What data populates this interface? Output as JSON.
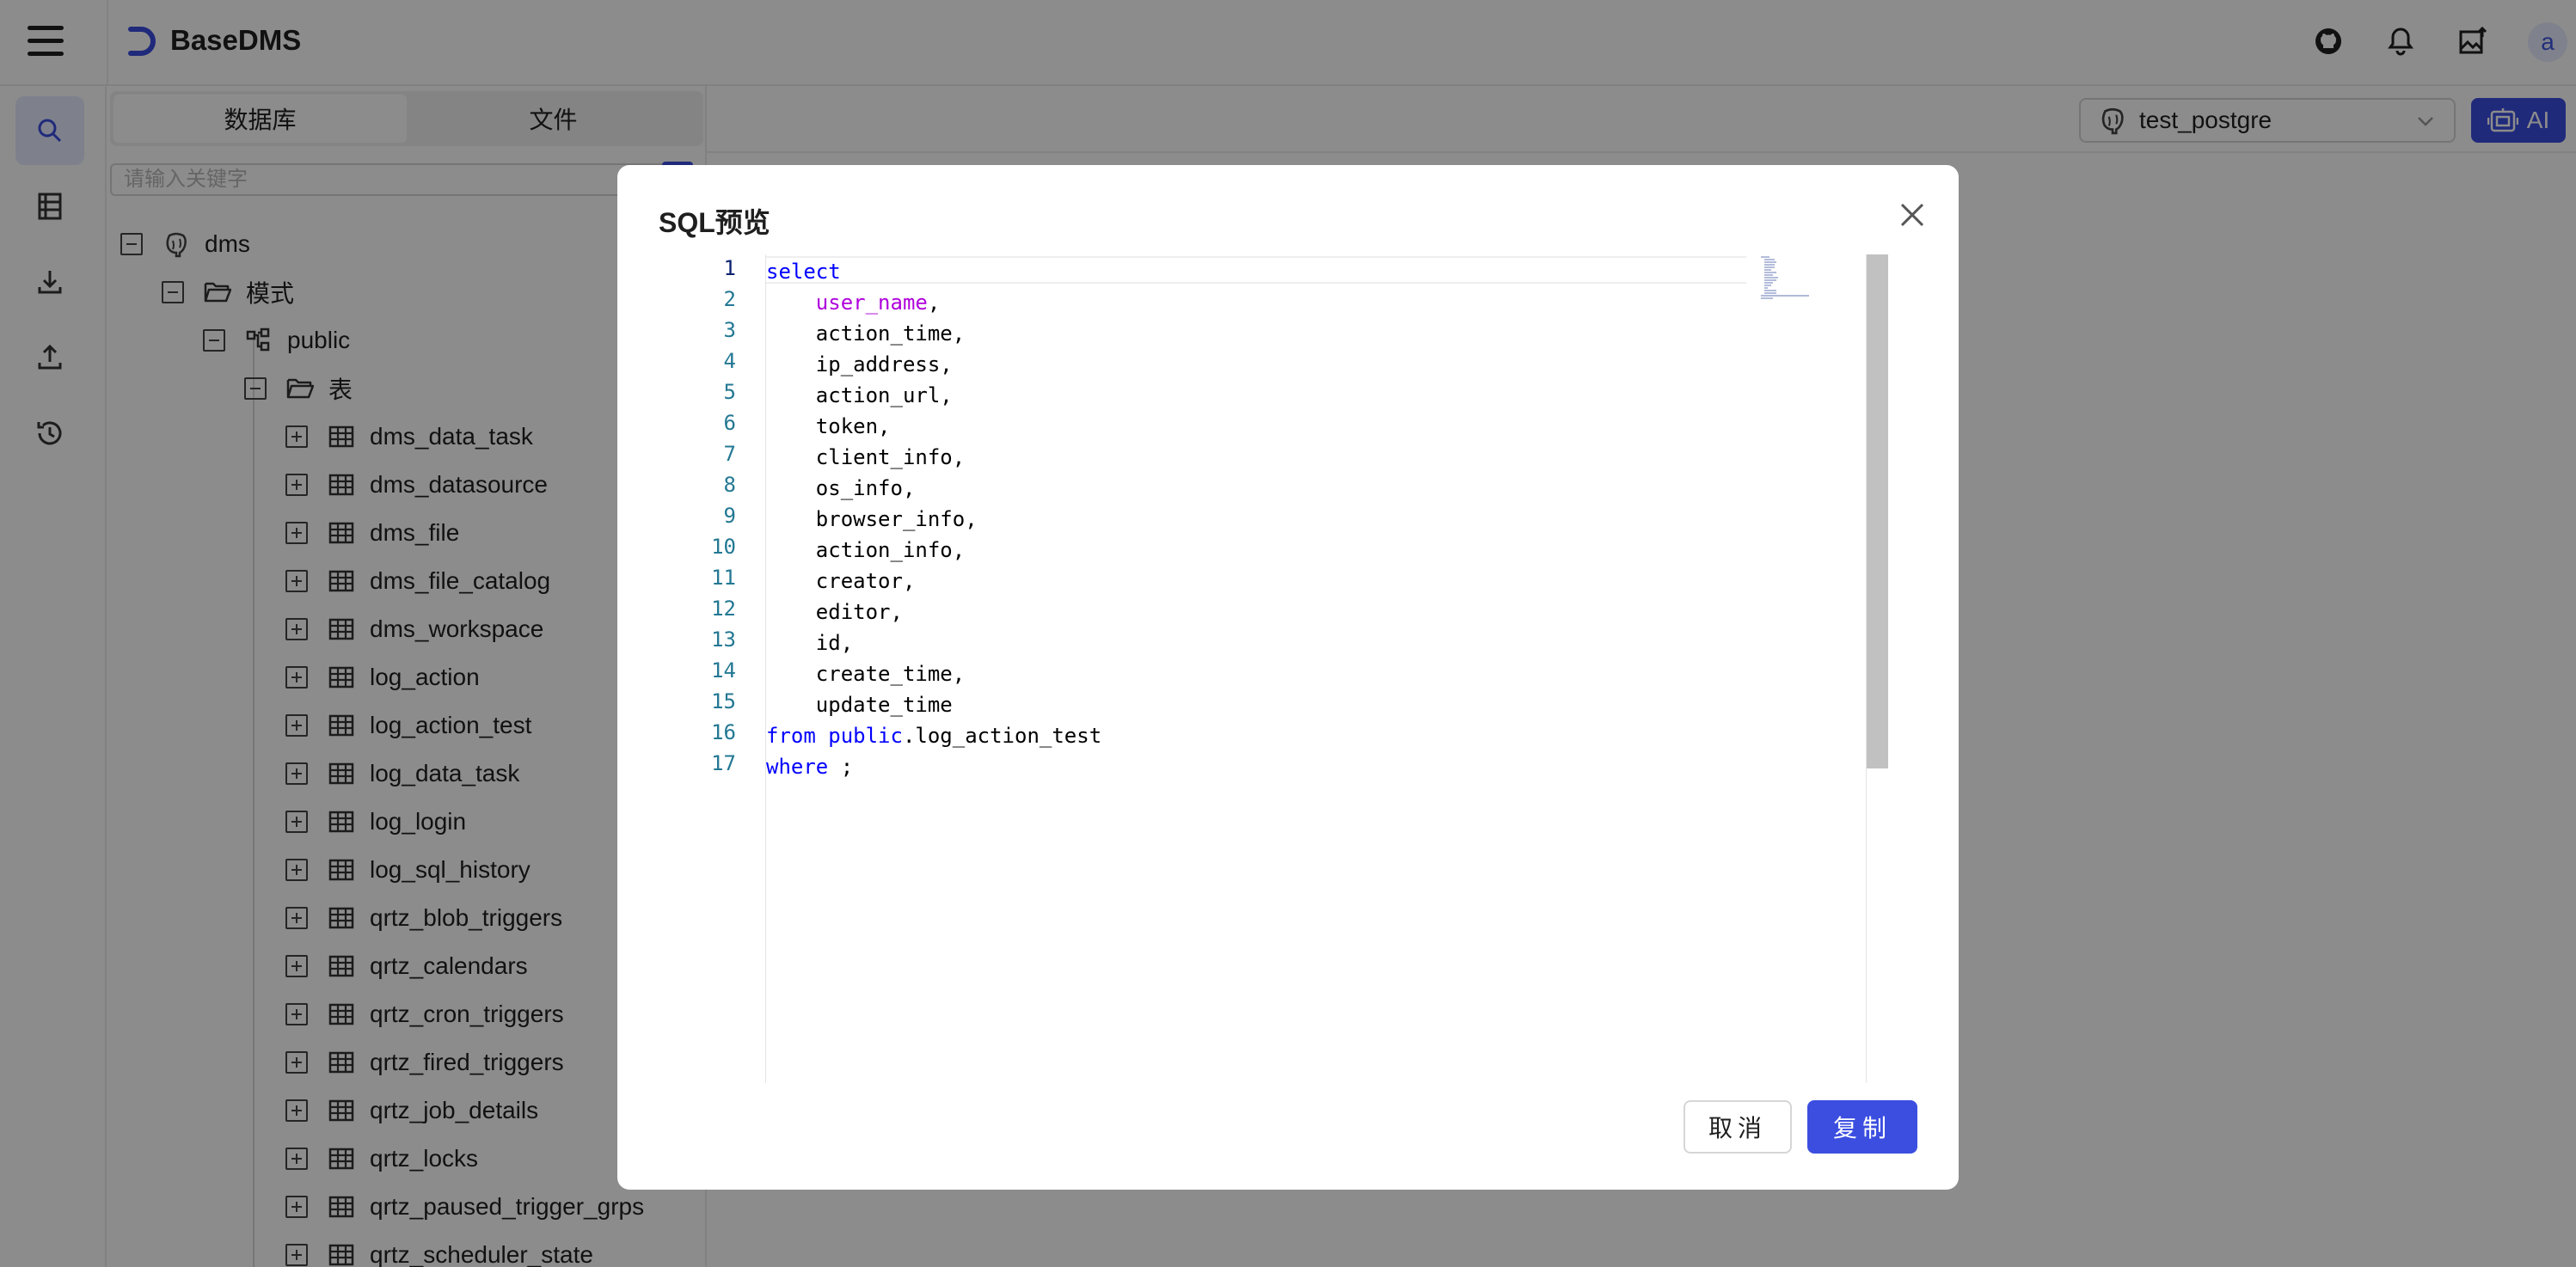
{
  "app": {
    "title": "BaseDMS",
    "accent": "#3b4ee0",
    "user_initial": "a"
  },
  "header": {
    "icons": [
      "github-icon",
      "bell-icon",
      "image-upload-icon"
    ]
  },
  "rail": {
    "items": [
      "search-icon",
      "table-list-icon",
      "download-icon",
      "upload-icon",
      "history-icon"
    ],
    "active": "search-icon"
  },
  "explorer": {
    "tabs": [
      {
        "label": "数据库",
        "active": true
      },
      {
        "label": "文件",
        "active": false
      }
    ],
    "search_placeholder": "请输入关键字",
    "tree": {
      "root": "dms",
      "schema_folder": "模式",
      "schema": "public",
      "table_folder": "表",
      "tables": [
        "dms_data_task",
        "dms_datasource",
        "dms_file",
        "dms_file_catalog",
        "dms_workspace",
        "log_action",
        "log_action_test",
        "log_data_task",
        "log_login",
        "log_sql_history",
        "qrtz_blob_triggers",
        "qrtz_calendars",
        "qrtz_cron_triggers",
        "qrtz_fired_triggers",
        "qrtz_job_details",
        "qrtz_locks",
        "qrtz_paused_trigger_grps",
        "qrtz_scheduler_state"
      ]
    }
  },
  "toolbar": {
    "datasource": "test_postgre",
    "ai_label": "AI"
  },
  "modal": {
    "title": "SQL预览",
    "cancel_label": "取消",
    "copy_label": "复制",
    "sql_lines": [
      {
        "n": "1",
        "parts": [
          {
            "t": "select",
            "c": "kw"
          }
        ]
      },
      {
        "n": "2",
        "parts": [
          {
            "t": "    ",
            "c": ""
          },
          {
            "t": "user_name",
            "c": "fn"
          },
          {
            "t": ",",
            "c": ""
          }
        ]
      },
      {
        "n": "3",
        "parts": [
          {
            "t": "    action_time,",
            "c": ""
          }
        ]
      },
      {
        "n": "4",
        "parts": [
          {
            "t": "    ip_address,",
            "c": ""
          }
        ]
      },
      {
        "n": "5",
        "parts": [
          {
            "t": "    action_url,",
            "c": ""
          }
        ]
      },
      {
        "n": "6",
        "parts": [
          {
            "t": "    token,",
            "c": ""
          }
        ]
      },
      {
        "n": "7",
        "parts": [
          {
            "t": "    client_info,",
            "c": ""
          }
        ]
      },
      {
        "n": "8",
        "parts": [
          {
            "t": "    os_info,",
            "c": ""
          }
        ]
      },
      {
        "n": "9",
        "parts": [
          {
            "t": "    browser_info,",
            "c": ""
          }
        ]
      },
      {
        "n": "10",
        "parts": [
          {
            "t": "    action_info,",
            "c": ""
          }
        ]
      },
      {
        "n": "11",
        "parts": [
          {
            "t": "    creator,",
            "c": ""
          }
        ]
      },
      {
        "n": "12",
        "parts": [
          {
            "t": "    editor,",
            "c": ""
          }
        ]
      },
      {
        "n": "13",
        "parts": [
          {
            "t": "    id,",
            "c": ""
          }
        ]
      },
      {
        "n": "14",
        "parts": [
          {
            "t": "    create_time,",
            "c": ""
          }
        ]
      },
      {
        "n": "15",
        "parts": [
          {
            "t": "    update_time",
            "c": ""
          }
        ]
      },
      {
        "n": "16",
        "parts": [
          {
            "t": "from",
            "c": "kw"
          },
          {
            "t": " ",
            "c": ""
          },
          {
            "t": "public",
            "c": "kw"
          },
          {
            "t": ".log_action_test",
            "c": ""
          }
        ]
      },
      {
        "n": "17",
        "parts": [
          {
            "t": "where",
            "c": "kw"
          },
          {
            "t": " ;",
            "c": ""
          }
        ]
      }
    ]
  }
}
